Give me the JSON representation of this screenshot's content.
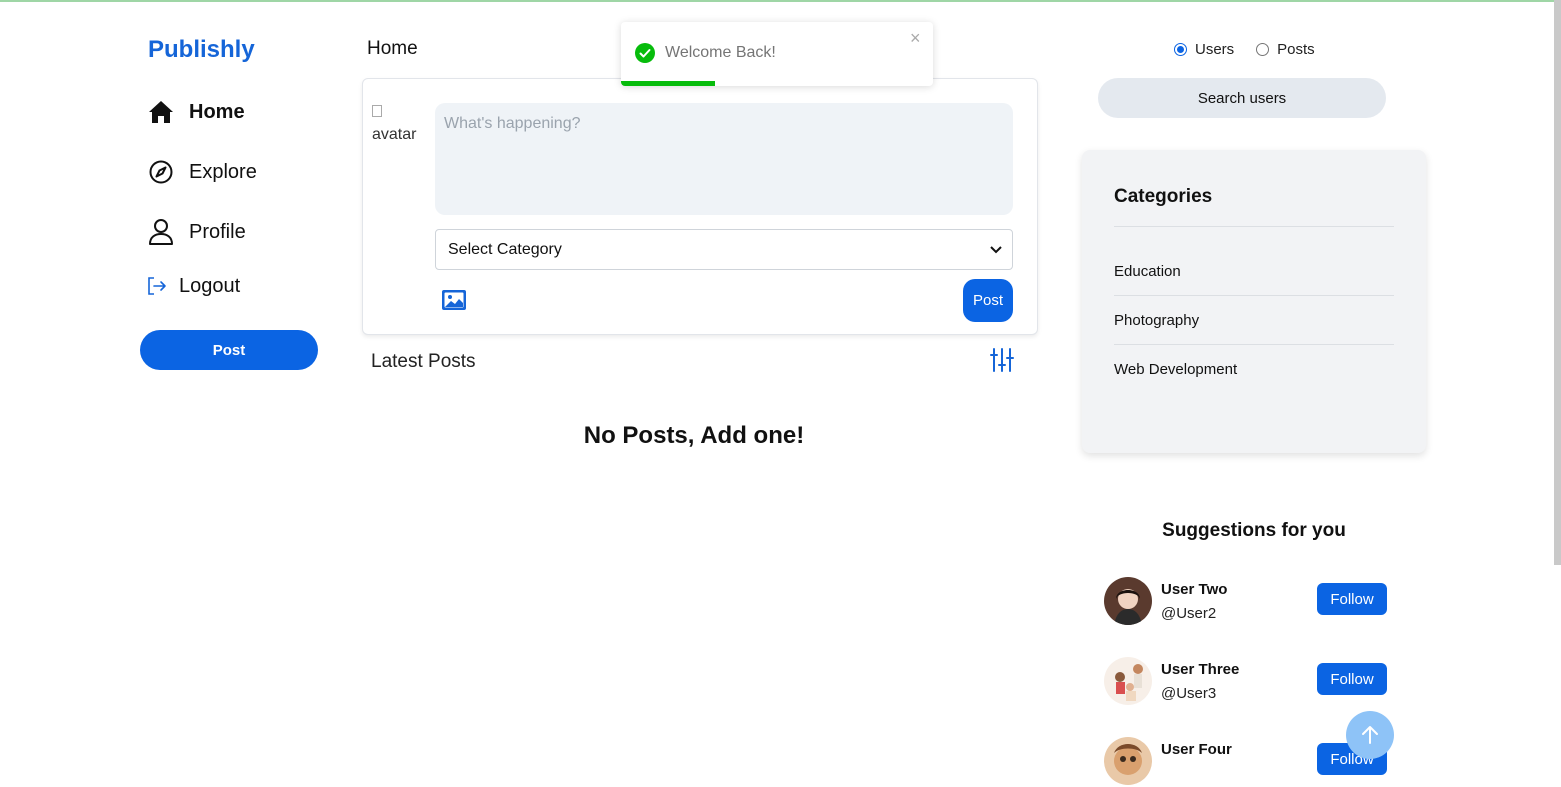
{
  "brand": "Publishly",
  "nav": {
    "home": "Home",
    "explore": "Explore",
    "profile": "Profile",
    "logout": "Logout",
    "post_button": "Post"
  },
  "main": {
    "title": "Home",
    "composer": {
      "avatar_alt": "avatar",
      "placeholder": "What's happening?",
      "category_select": "Select Category",
      "post_button": "Post"
    },
    "latest_title": "Latest Posts",
    "empty_message": "No Posts, Add one!"
  },
  "toast": {
    "message": "Welcome Back!",
    "close": "×",
    "progress": 0.3
  },
  "search": {
    "radio_users": "Users",
    "radio_posts": "Posts",
    "selected": "Users",
    "button": "Search users"
  },
  "categories": {
    "title": "Categories",
    "items": [
      "Education",
      "Photography",
      "Web Development"
    ]
  },
  "suggestions": {
    "title": "Suggestions for you",
    "follow_label": "Follow",
    "users": [
      {
        "name": "User Two",
        "handle": "@User2"
      },
      {
        "name": "User Three",
        "handle": "@User3"
      },
      {
        "name": "User Four",
        "handle": ""
      }
    ]
  },
  "colors": {
    "accent": "#0b64e3",
    "brand": "#1565d8",
    "success": "#07bc0c"
  }
}
